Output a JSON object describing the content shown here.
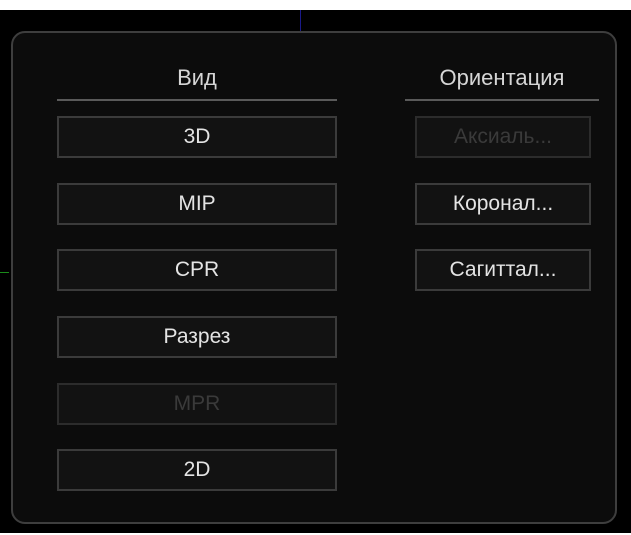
{
  "panel": {
    "view_column": {
      "title": "Вид",
      "buttons": [
        {
          "label": "3D",
          "enabled": true
        },
        {
          "label": "MIP",
          "enabled": true
        },
        {
          "label": "CPR",
          "enabled": true
        },
        {
          "label": "Разрез",
          "enabled": true
        },
        {
          "label": "MPR",
          "enabled": false
        },
        {
          "label": "2D",
          "enabled": true
        }
      ]
    },
    "orientation_column": {
      "title": "Ориентация",
      "buttons": [
        {
          "label": "Аксиаль...",
          "enabled": false
        },
        {
          "label": "Коронал...",
          "enabled": true
        },
        {
          "label": "Сагиттал...",
          "enabled": true
        }
      ]
    }
  },
  "colors": {
    "background": "#000000",
    "panel_border": "#3e3e3e",
    "button_border": "#3b3b3b",
    "text": "#e4e4e4",
    "disabled_text": "#3a3a3a"
  }
}
